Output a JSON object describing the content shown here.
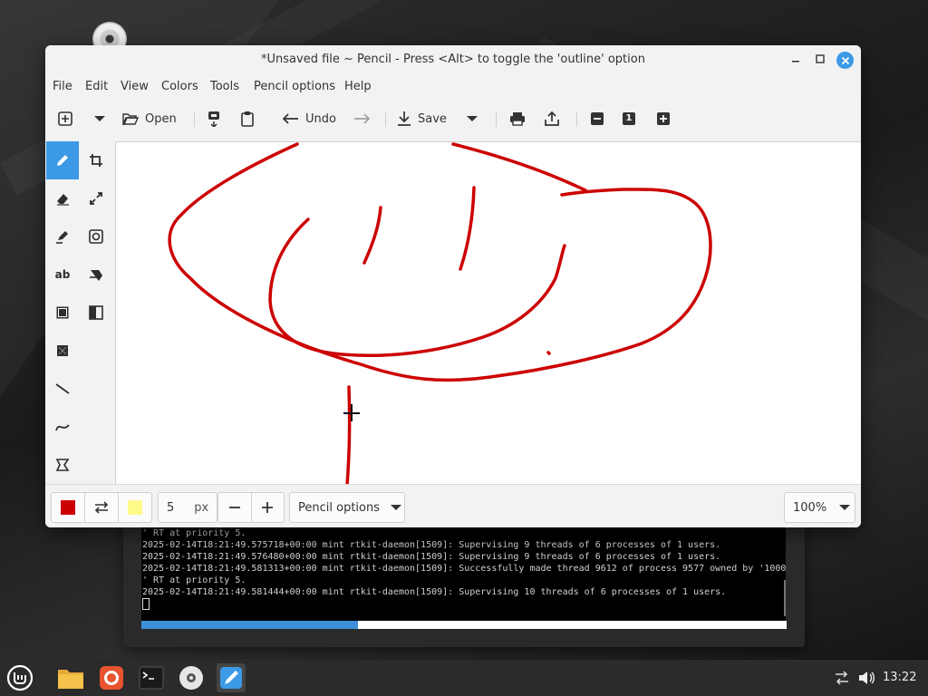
{
  "window": {
    "title": "*Unsaved file ~ Pencil - Press <Alt> to toggle the 'outline' option"
  },
  "menu": [
    "File",
    "Edit",
    "View",
    "Colors",
    "Tools",
    "Pencil options",
    "Help"
  ],
  "toolbar": {
    "open_label": "Open",
    "undo_label": "Undo",
    "save_label": "Save",
    "zoom_badge": "1"
  },
  "tools": [
    {
      "name": "pencil",
      "active": true
    },
    {
      "name": "crop",
      "active": false
    },
    {
      "name": "eraser",
      "active": false
    },
    {
      "name": "scale",
      "active": false
    },
    {
      "name": "highlighter",
      "active": false
    },
    {
      "name": "rotate",
      "active": false
    },
    {
      "name": "text",
      "label": "ab",
      "active": false
    },
    {
      "name": "skew",
      "active": false
    },
    {
      "name": "rectangle",
      "active": false
    },
    {
      "name": "filters",
      "active": false
    },
    {
      "name": "selection",
      "active": false
    },
    {
      "name": "line",
      "active": false
    },
    {
      "name": "curve",
      "active": false
    },
    {
      "name": "free-shape",
      "active": false
    }
  ],
  "bottom": {
    "main_color": "#cc0000",
    "secondary_color": "#fff98a",
    "size_value": "5",
    "size_unit": "px",
    "options_label": "Pencil options",
    "zoom_value": "100%"
  },
  "terminal": {
    "lines": [
      "' RT at priority 5.",
      "2025-02-14T18:21:49.575718+00:00 mint rtkit-daemon[1509]: Supervising 9 threads of 6 processes of 1 users.",
      "2025-02-14T18:21:49.576480+00:00 mint rtkit-daemon[1509]: Supervising 9 threads of 6 processes of 1 users.",
      "2025-02-14T18:21:49.581313+00:00 mint rtkit-daemon[1509]: Successfully made thread 9612 of process 9577 owned by '1000",
      "' RT at priority 5.",
      "2025-02-14T18:21:49.581444+00:00 mint rtkit-daemon[1509]: Supervising 10 threads of 6 processes of 1 users."
    ],
    "progress_fraction": 0.335
  },
  "taskbar": {
    "clock": "13:22"
  },
  "colors": {
    "accent": "#3c9ae6",
    "stroke": "#cc0000"
  }
}
